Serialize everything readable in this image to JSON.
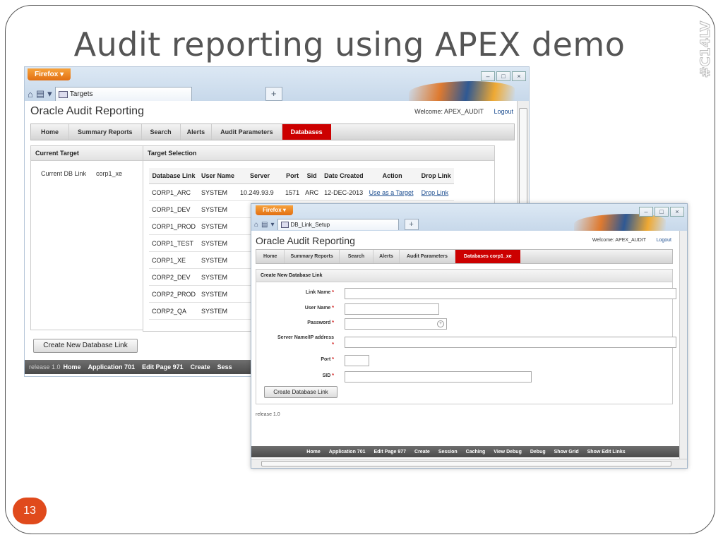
{
  "slide": {
    "title": "Audit reporting using APEX demo",
    "hashtag": "#C14LV",
    "page_number": "13"
  },
  "browser": {
    "firefox_label": "Firefox",
    "win_min": "–",
    "win_max": "□",
    "win_close": "×",
    "new_tab": "+"
  },
  "window1": {
    "tab_title": "Targets",
    "app_title": "Oracle Audit Reporting",
    "welcome": "Welcome: APEX_AUDIT",
    "logout": "Logout",
    "tabs": [
      "Home",
      "Summary Reports",
      "Search",
      "Alerts",
      "Audit Parameters",
      "Databases"
    ],
    "current_target": {
      "heading": "Current Target",
      "label": "Current DB Link",
      "value": "corp1_xe"
    },
    "target_selection": {
      "heading": "Target Selection",
      "columns": [
        "Database Link",
        "User Name",
        "Server",
        "Port",
        "Sid",
        "Date Created",
        "Action",
        "Drop Link"
      ],
      "first_row": {
        "db_link": "CORP1_ARC",
        "user": "SYSTEM",
        "server": "10.249.93.9",
        "port": "1571",
        "sid": "ARC",
        "date": "12-DEC-2013",
        "action": "Use as a Target",
        "drop": "Drop Link"
      },
      "rows": [
        {
          "db_link": "CORP1_DEV",
          "user": "SYSTEM"
        },
        {
          "db_link": "CORP1_PROD",
          "user": "SYSTEM"
        },
        {
          "db_link": "CORP1_TEST",
          "user": "SYSTEM"
        },
        {
          "db_link": "CORP1_XE",
          "user": "SYSTEM"
        },
        {
          "db_link": "CORP2_DEV",
          "user": "SYSTEM"
        },
        {
          "db_link": "CORP2_PROD",
          "user": "SYSTEM"
        },
        {
          "db_link": "CORP2_QA",
          "user": "SYSTEM"
        }
      ]
    },
    "create_button": "Create New Database Link",
    "dev_bar": {
      "release": "release 1.0",
      "items": [
        "Home",
        "Application 701",
        "Edit Page 971",
        "Create",
        "Sess"
      ]
    }
  },
  "window2": {
    "tab_title": "DB_Link_Setup",
    "app_title": "Oracle Audit Reporting",
    "welcome": "Welcome: APEX_AUDIT",
    "logout": "Logout",
    "tabs": [
      "Home",
      "Summary Reports",
      "Search",
      "Alerts",
      "Audit Parameters",
      "Databases corp1_xe"
    ],
    "form": {
      "heading": "Create New Database Link",
      "link_name": "Link Name",
      "user_name": "User Name",
      "password": "Password",
      "server": "Server Name/IP address",
      "port": "Port",
      "sid": "SID",
      "required_mark": "*",
      "button": "Create Database Link"
    },
    "release": "release 1.0",
    "dev_bar": [
      "Home",
      "Application 701",
      "Edit Page 977",
      "Create",
      "Session",
      "Caching",
      "View Debug",
      "Debug",
      "Show Grid",
      "Show Edit Links"
    ]
  }
}
